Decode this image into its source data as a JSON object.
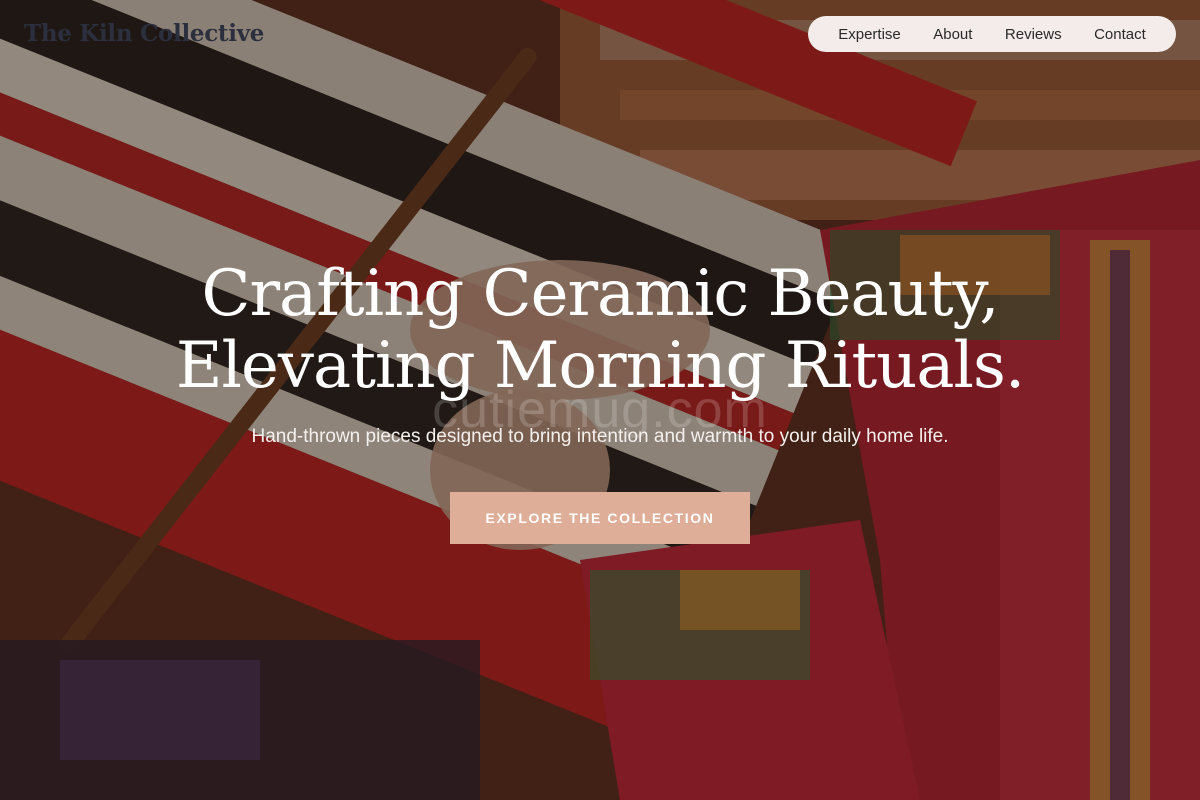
{
  "brand": {
    "logo": "The Kiln Collective"
  },
  "nav": {
    "items": [
      {
        "label": "Expertise"
      },
      {
        "label": "About"
      },
      {
        "label": "Reviews"
      },
      {
        "label": "Contact"
      }
    ]
  },
  "hero": {
    "headline_line1": "Crafting Ceramic Beauty,",
    "headline_line2": "Elevating Morning Rituals.",
    "watermark": "cutiemug.com",
    "subtitle": "Hand-thrown pieces designed to bring intention and warmth to your daily home life.",
    "cta_label": "EXPLORE THE COLLECTION"
  },
  "colors": {
    "cta_background": "#dfae98",
    "nav_background": "#f3ecea",
    "logo_text": "#2b2f3e"
  }
}
